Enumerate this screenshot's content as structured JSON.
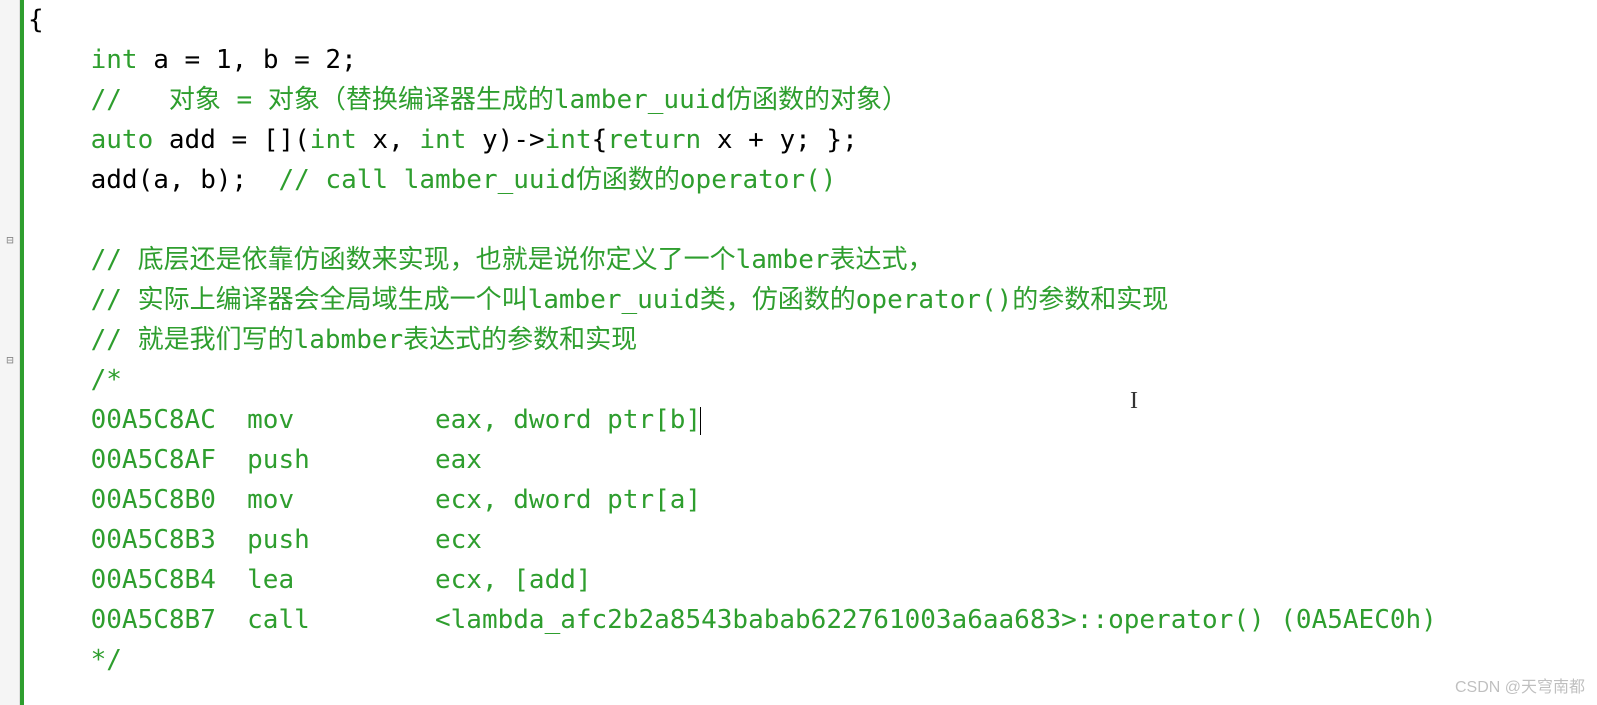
{
  "code": {
    "l1_brace": "{",
    "l2_kw1": "int",
    "l2_rest": " a = 1, b = 2;",
    "l3_comment": "//   对象 = 对象（替换编译器生成的lamber_uuid仿函数的对象）",
    "l4_kw1": "auto",
    "l4_mid1": " add = [](",
    "l4_kw2": "int",
    "l4_mid2": " x, ",
    "l4_kw3": "int",
    "l4_mid3": " y)->",
    "l4_kw4": "int",
    "l4_mid4": "{",
    "l4_kw5": "return",
    "l4_mid5": " x + y; };",
    "l5_call": "add(a, b);  ",
    "l5_comment": "// call lamber_uuid仿函数的operator()",
    "l7_comment": "// 底层还是依靠仿函数来实现，也就是说你定义了一个lamber表达式，",
    "l8_comment": "// 实际上编译器会全局域生成一个叫lamber_uuid类，仿函数的operator()的参数和实现",
    "l9_comment": "// 就是我们写的labmber表达式的参数和实现",
    "l10_cstart": "/*",
    "l11": "00A5C8AC  mov         eax, dword ptr[b]",
    "l12": "00A5C8AF  push        eax",
    "l13": "00A5C8B0  mov         ecx, dword ptr[a]",
    "l14": "00A5C8B3  push        ecx",
    "l15": "00A5C8B4  lea         ecx, [add]",
    "l16": "00A5C8B7  call        <lambda_afc2b2a8543babab622761003a6aa683>::operator() (0A5AEC0h)",
    "l17_cend": "*/"
  },
  "watermark": "CSDN @天穹南都"
}
